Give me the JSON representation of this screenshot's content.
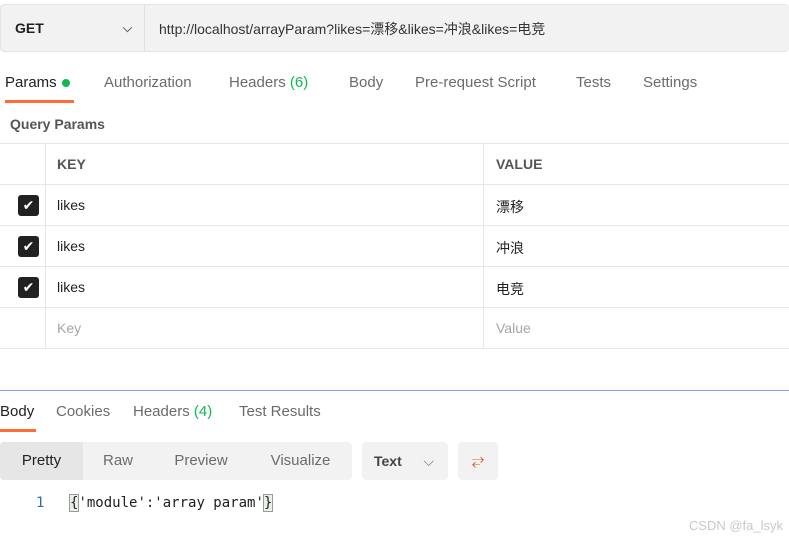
{
  "request": {
    "method": "GET",
    "url": "http://localhost/arrayParam?likes=漂移&likes=冲浪&likes=电竞"
  },
  "request_tabs": [
    {
      "label": "Params"
    },
    {
      "label": "Authorization"
    },
    {
      "label": "Headers",
      "count": "(6)"
    },
    {
      "label": "Body"
    },
    {
      "label": "Pre-request Script"
    },
    {
      "label": "Tests"
    },
    {
      "label": "Settings"
    }
  ],
  "query_params": {
    "title": "Query Params",
    "headers": [
      "KEY",
      "VALUE"
    ],
    "rows": [
      {
        "checked": true,
        "key": "likes",
        "value": "漂移"
      },
      {
        "checked": true,
        "key": "likes",
        "value": "冲浪"
      },
      {
        "checked": true,
        "key": "likes",
        "value": "电竞"
      }
    ],
    "placeholder_key": "Key",
    "placeholder_value": "Value"
  },
  "response_tabs": [
    {
      "label": "Body"
    },
    {
      "label": "Cookies"
    },
    {
      "label": "Headers",
      "count": "(4)"
    },
    {
      "label": "Test Results"
    }
  ],
  "view_modes": [
    "Pretty",
    "Raw",
    "Preview",
    "Visualize"
  ],
  "format": "Text",
  "code": {
    "line": "1",
    "open": "{",
    "content": "'module':'array param'",
    "close": "}"
  },
  "watermark": "CSDN @fa_lsyk",
  "colors": {
    "accent": "#ff6c37",
    "green": "#0cbb52"
  }
}
